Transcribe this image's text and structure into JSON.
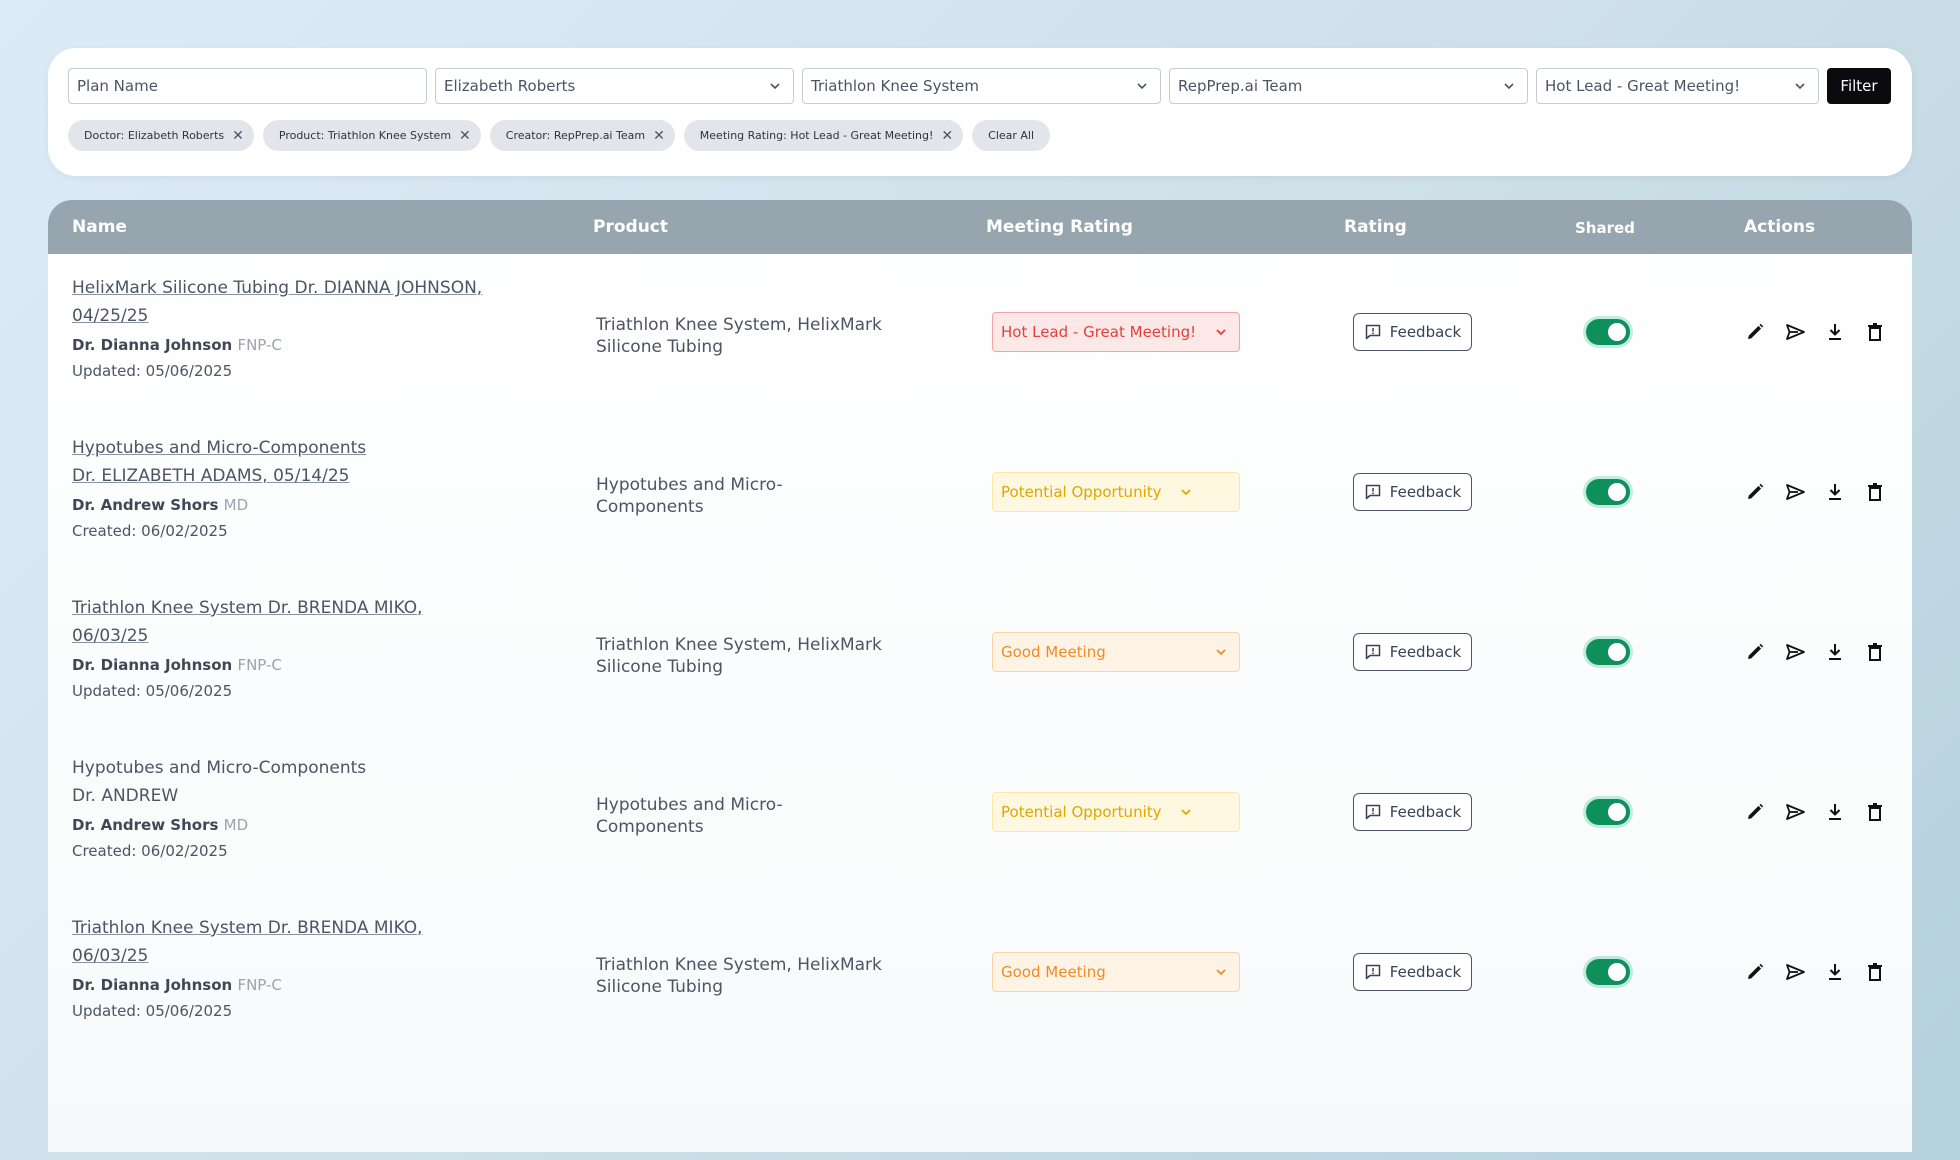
{
  "filters": {
    "plan_name_placeholder": "Plan Name",
    "doctor_selected": "Elizabeth Roberts",
    "product_selected": "Triathlon Knee System",
    "creator_selected": "RepPrep.ai Team",
    "rating_selected": "Hot Lead - Great Meeting!",
    "filter_button": "Filter"
  },
  "chips": [
    {
      "label": "Doctor: Elizabeth Roberts"
    },
    {
      "label": "Product: Triathlon Knee System"
    },
    {
      "label": "Creator: RepPrep.ai Team"
    },
    {
      "label": "Meeting Rating: Hot Lead - Great Meeting!"
    }
  ],
  "clear_all": "Clear All",
  "table": {
    "headers": {
      "name": "Name",
      "product": "Product",
      "meeting_rating": "Meeting Rating",
      "rating": "Rating",
      "shared": "Shared",
      "actions": "Actions"
    },
    "rows": [
      {
        "plan_line1": "HelixMark Silicone Tubing Dr. DIANNA JOHNSON,",
        "plan_line2": "04/25/25",
        "doctor": "Dr. Dianna Johnson",
        "credential": "FNP-C",
        "date": "Updated: 05/06/2025",
        "product_line1": "Triathlon Knee System, HelixMark",
        "product_line2": "Silicone Tubing",
        "meeting_rating": "Hot Lead - Great Meeting!",
        "rating_style": "hot",
        "feedback": "Feedback",
        "shared": true
      },
      {
        "plan_line1": "Hypotubes and Micro-Components",
        "plan_line2": "Dr. ELIZABETH ADAMS, 05/14/25",
        "doctor": "Dr. Andrew Shors",
        "credential": "MD",
        "date": "Created: 06/02/2025",
        "product_line1": "Hypotubes and Micro-",
        "product_line2": "Components",
        "meeting_rating": "Potential Opportunity",
        "rating_style": "pot",
        "feedback": "Feedback",
        "shared": true
      },
      {
        "plan_line1": "Triathlon Knee System Dr. BRENDA MIKO,",
        "plan_line2": "06/03/25",
        "doctor": "Dr. Dianna Johnson",
        "credential": "FNP-C",
        "date": "Updated: 05/06/2025",
        "product_line1": "Triathlon Knee System, HelixMark",
        "product_line2": "Silicone Tubing",
        "meeting_rating": "Good Meeting",
        "rating_style": "good",
        "feedback": "Feedback",
        "shared": true
      },
      {
        "plan_line1": "Hypotubes and Micro-Components",
        "plan_line2": "Dr. ANDREW",
        "doctor": "Dr. Andrew Shors",
        "credential": "MD",
        "date": "Created: 06/02/2025",
        "product_line1": "Hypotubes and Micro-",
        "product_line2": "Components",
        "meeting_rating": "Potential Opportunity",
        "rating_style": "pot",
        "feedback": "Feedback",
        "shared": true
      },
      {
        "plan_line1": "Triathlon Knee System Dr. BRENDA MIKO,",
        "plan_line2": "06/03/25",
        "doctor": "Dr. Dianna Johnson",
        "credential": "FNP-C",
        "date": "Updated: 05/06/2025",
        "product_line1": "Triathlon Knee System, HelixMark",
        "product_line2": "Silicone Tubing",
        "meeting_rating": "Good Meeting",
        "rating_style": "good",
        "feedback": "Feedback",
        "shared": true
      }
    ]
  },
  "icons": {
    "dropdown": "chevron-down-icon",
    "chip_remove": "close-icon",
    "feedback": "comment-alert-icon",
    "actions": [
      "pencil-icon",
      "send-icon",
      "download-icon",
      "trash-icon"
    ]
  },
  "colors": {
    "header_bg": "#97a5af",
    "hot": "#e53e3e",
    "potential": "#e0a500",
    "good": "#f08a24",
    "toggle_on": "#0f8f5c"
  }
}
